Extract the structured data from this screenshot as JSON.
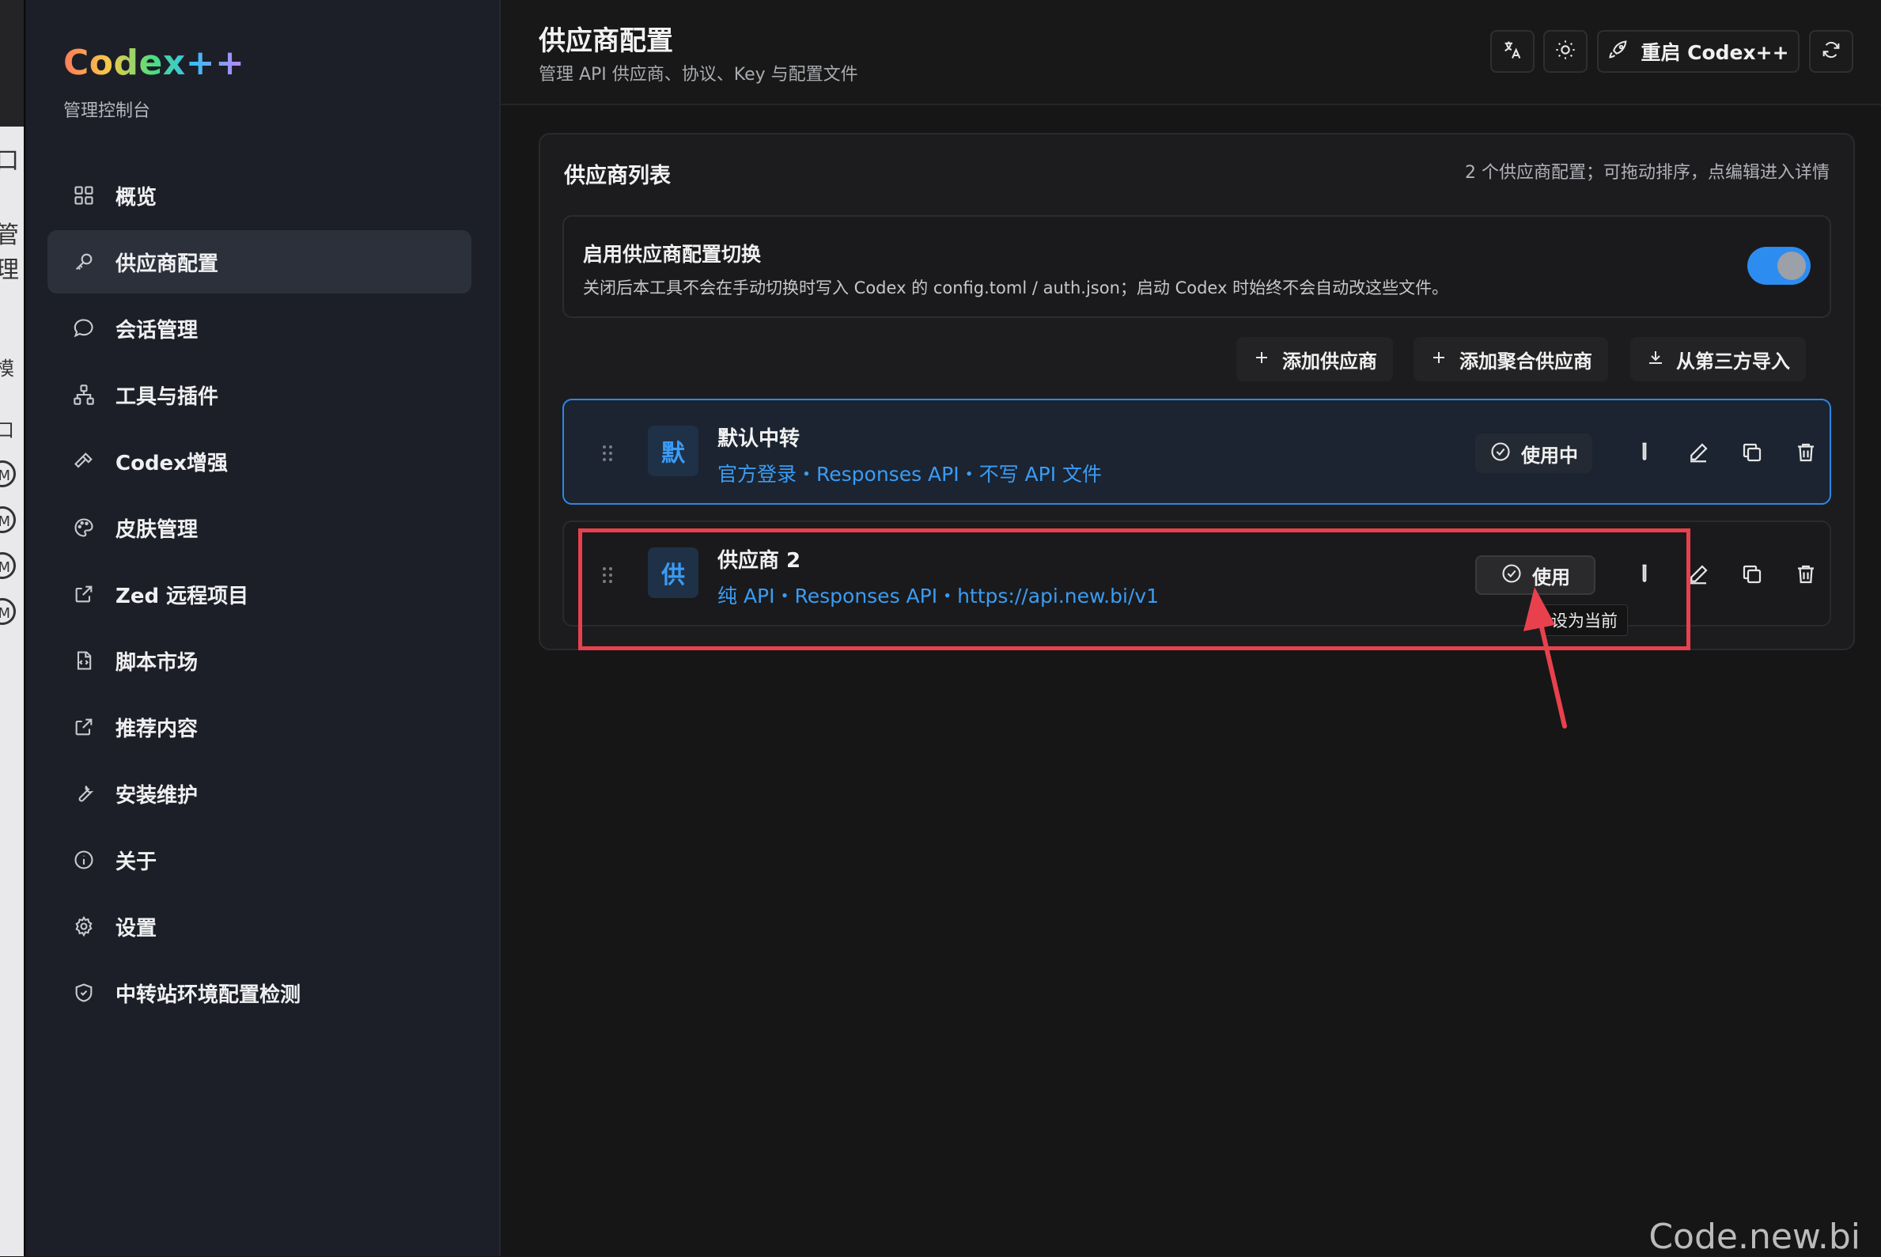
{
  "background_window": {
    "visible_fragments": [
      "口",
      "管理",
      "模",
      "口"
    ],
    "circle_marks": [
      "M",
      "M",
      "M",
      "M"
    ]
  },
  "sidebar": {
    "logo": "Codex++",
    "subtitle": "管理控制台",
    "items": [
      {
        "label": "概览",
        "icon": "grid-icon",
        "active": false
      },
      {
        "label": "供应商配置",
        "icon": "key-icon",
        "active": true
      },
      {
        "label": "会话管理",
        "icon": "chat-bubble-icon",
        "active": false
      },
      {
        "label": "工具与插件",
        "icon": "network-icon",
        "active": false
      },
      {
        "label": "Codex增强",
        "icon": "hammer-icon",
        "active": false
      },
      {
        "label": "皮肤管理",
        "icon": "palette-icon",
        "active": false
      },
      {
        "label": "Zed 远程项目",
        "icon": "external-link-icon",
        "active": false
      },
      {
        "label": "脚本市场",
        "icon": "script-file-icon",
        "active": false
      },
      {
        "label": "推荐内容",
        "icon": "external-link-icon",
        "active": false
      },
      {
        "label": "安装维护",
        "icon": "wrench-icon",
        "active": false
      },
      {
        "label": "关于",
        "icon": "info-icon",
        "active": false
      },
      {
        "label": "设置",
        "icon": "gear-icon",
        "active": false
      },
      {
        "label": "中转站环境配置检测",
        "icon": "shield-icon",
        "active": false
      }
    ]
  },
  "header": {
    "title": "供应商配置",
    "subtitle": "管理 API 供应商、协议、Key 与配置文件",
    "restart_label": "重启 Codex++"
  },
  "provider_list": {
    "title": "供应商列表",
    "meta": "2 个供应商配置；可拖动排序，点编辑进入详情",
    "switch": {
      "title": "启用供应商配置切换",
      "description": "关闭后本工具不会在手动切换时写入 Codex 的 config.toml / auth.json；启动 Codex 时始终不会自动改这些文件。",
      "enabled": true
    },
    "actions": {
      "add_provider": "添加供应商",
      "add_aggregate": "添加聚合供应商",
      "import_third_party": "从第三方导入"
    },
    "providers": [
      {
        "avatar": "默",
        "name": "默认中转",
        "description": "官方登录・Responses API・不写 API 文件",
        "status_label": "使用中"
      },
      {
        "avatar": "供",
        "name": "供应商 2",
        "description": "纯 API・Responses API・https://api.new.bi/v1",
        "status_label": "使用"
      }
    ],
    "tooltip": "设为当前"
  },
  "colors": {
    "accent": "#2f86e6",
    "link": "#3a9cf5",
    "annotation": "#e8414d"
  },
  "watermark": "Code.new.bi"
}
